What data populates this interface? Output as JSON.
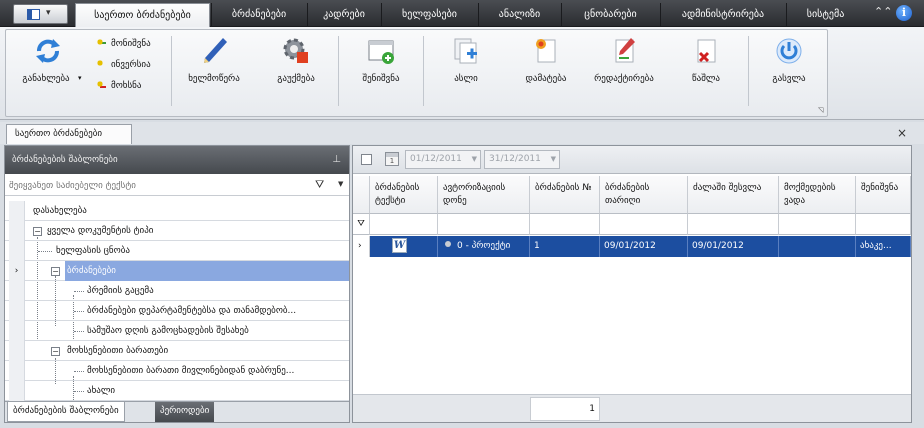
{
  "app_menu": {
    "icon": "layout-icon"
  },
  "top_tabs": [
    {
      "label": "საერთო ბრძანებები",
      "active": true
    },
    {
      "label": "ბრძანებები",
      "active": false
    },
    {
      "label": "კადრები",
      "active": false
    },
    {
      "label": "ხელფასები",
      "active": false
    },
    {
      "label": "ანალიზი",
      "active": false
    },
    {
      "label": "ცნობარები",
      "active": false
    },
    {
      "label": "ადმინისტრირება",
      "active": false
    },
    {
      "label": "სისტემა",
      "active": false
    }
  ],
  "ribbon": {
    "refresh_label": "განახლება",
    "assign_label": "მონიშვნა",
    "invert_label": "ინვერსია",
    "remove_label": "მოხსნა",
    "sign_label": "ხელმოწერა",
    "settings_label": "გაუქმება",
    "save_label": "შენიშვნა",
    "copy_label": "ასლი",
    "add_label": "დამატება",
    "edit_label": "რედაქტირება",
    "delete_label": "წაშლა",
    "exit_label": "გასვლა"
  },
  "doc_tab": {
    "label": "საერთო ბრძანებები"
  },
  "left_pane": {
    "title": "ბრძანებების შაბლონები",
    "filter_placeholder": "შეიყვანეთ საძიებელი ტექსტი",
    "tree_header": "დასახელება",
    "tree": [
      {
        "label": "ყველა დოკუმენტის ტიპი",
        "level": 0,
        "toggle": "−"
      },
      {
        "label": "ხელფასის ცნობა",
        "level": 1
      },
      {
        "label": "ბრძანებები",
        "level": 1,
        "toggle": "−",
        "selected": true
      },
      {
        "label": "პრემიის გაცემა",
        "level": 2
      },
      {
        "label": "ბრძანებები დეპარტამენტებსა და თანამდებობ...",
        "level": 2
      },
      {
        "label": "სამუშაო დღის გამოცხადების შესახებ",
        "level": 2
      },
      {
        "label": "მოხსენებითი ბარათები",
        "level": 1,
        "toggle": "−"
      },
      {
        "label": "მოხსენებითი ბარათი მივლინებიდან დაბრუნე...",
        "level": 2
      },
      {
        "label": "ახალი",
        "level": 2
      }
    ],
    "footer_tabs": [
      {
        "label": "ბრძანებების შაბლონები",
        "active": true
      },
      {
        "label": "პერიოდები",
        "active": false
      }
    ]
  },
  "right_pane": {
    "date_from": "01/12/2011",
    "date_to": "31/12/2011",
    "columns": [
      "ბრძანების ტექსტი",
      "ავტორიზაციის დონე",
      "ბრძანების №",
      "ბრძანების თარიღი",
      "ძალაში შესვლა",
      "მოქმედების ვადა",
      "შენიშვნა"
    ],
    "rows": [
      {
        "icon": "word-doc-icon",
        "icon_glyph": "W",
        "auth_level": "0 - პროექტი",
        "number": "1",
        "date": "09/01/2012",
        "effective": "09/01/2012",
        "validity": "",
        "note": "ახაკე..."
      }
    ],
    "row_count": "1"
  },
  "colors": {
    "selection": "#1c4ea0",
    "tree_selection": "#8aa8e0"
  }
}
